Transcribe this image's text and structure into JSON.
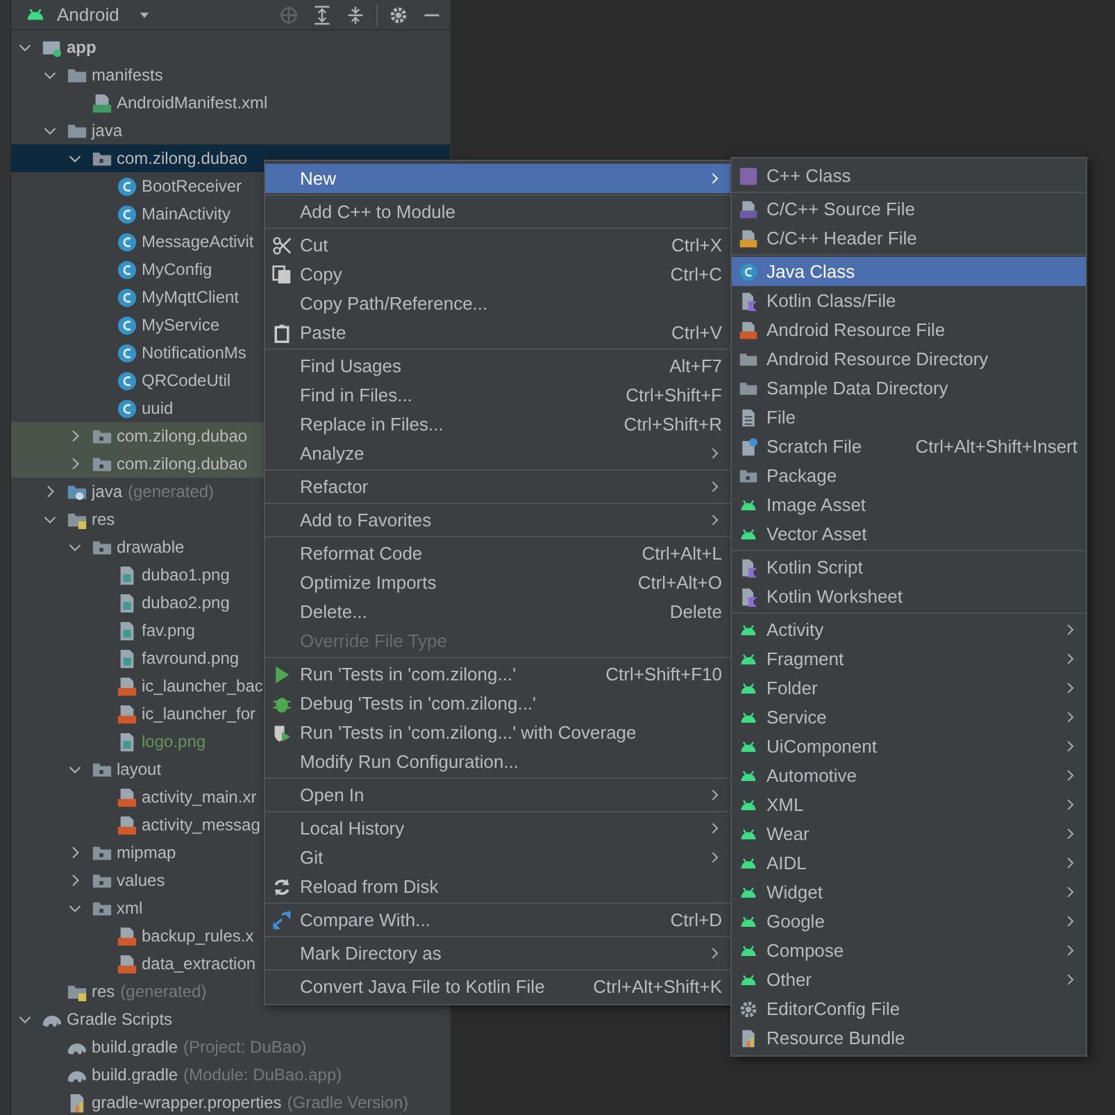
{
  "project_panel": {
    "view_selector": "Android",
    "tree": [
      {
        "label": "app",
        "kind": "module",
        "expanded": true,
        "selected": false,
        "children": [
          {
            "label": "manifests",
            "kind": "folder",
            "expanded": true,
            "selected": false,
            "children": [
              {
                "label": "AndroidManifest.xml",
                "kind": "manifest",
                "selected": false
              }
            ]
          },
          {
            "label": "java",
            "kind": "folder",
            "expanded": true,
            "selected": false,
            "children": [
              {
                "label": "com.zilong.dubao",
                "kind": "package",
                "expanded": true,
                "selected": true,
                "children": [
                  {
                    "label": "BootReceiver",
                    "kind": "class",
                    "selected": false
                  },
                  {
                    "label": "MainActivity",
                    "kind": "class",
                    "selected": false
                  },
                  {
                    "label": "MessageActivit",
                    "kind": "class",
                    "selected": false
                  },
                  {
                    "label": "MyConfig",
                    "kind": "class",
                    "selected": false
                  },
                  {
                    "label": "MyMqttClient",
                    "kind": "class",
                    "selected": false
                  },
                  {
                    "label": "MyService",
                    "kind": "class",
                    "selected": false
                  },
                  {
                    "label": "NotificationMs",
                    "kind": "class",
                    "selected": false
                  },
                  {
                    "label": "QRCodeUtil",
                    "kind": "class",
                    "selected": false
                  },
                  {
                    "label": "uuid",
                    "kind": "class",
                    "selected": false
                  }
                ]
              },
              {
                "label": "com.zilong.dubao",
                "kind": "package",
                "expanded": false,
                "selected": false,
                "test": true
              },
              {
                "label": "com.zilong.dubao",
                "kind": "package",
                "expanded": false,
                "selected": false,
                "test": true
              }
            ]
          },
          {
            "label": "java",
            "note": "(generated)",
            "kind": "generated",
            "expanded": false,
            "selected": false
          },
          {
            "label": "res",
            "kind": "res",
            "expanded": true,
            "selected": false,
            "children": [
              {
                "label": "drawable",
                "kind": "package",
                "expanded": true,
                "selected": false,
                "children": [
                  {
                    "label": "dubao1.png",
                    "kind": "image",
                    "selected": false
                  },
                  {
                    "label": "dubao2.png",
                    "kind": "image",
                    "selected": false
                  },
                  {
                    "label": "fav.png",
                    "kind": "image",
                    "selected": false
                  },
                  {
                    "label": "favround.png",
                    "kind": "image",
                    "selected": false
                  },
                  {
                    "label": "ic_launcher_bac",
                    "kind": "xml",
                    "selected": false
                  },
                  {
                    "label": "ic_launcher_for",
                    "kind": "xml",
                    "selected": false
                  },
                  {
                    "label": "logo.png",
                    "kind": "image",
                    "selected": false,
                    "added": true
                  }
                ]
              },
              {
                "label": "layout",
                "kind": "package",
                "expanded": true,
                "selected": false,
                "children": [
                  {
                    "label": "activity_main.xr",
                    "kind": "xml",
                    "selected": false
                  },
                  {
                    "label": "activity_messag",
                    "kind": "xml",
                    "selected": false
                  }
                ]
              },
              {
                "label": "mipmap",
                "kind": "package",
                "expanded": false,
                "selected": false
              },
              {
                "label": "values",
                "kind": "package",
                "expanded": false,
                "selected": false
              },
              {
                "label": "xml",
                "kind": "package",
                "expanded": true,
                "selected": false,
                "children": [
                  {
                    "label": "backup_rules.x",
                    "kind": "xml",
                    "selected": false
                  },
                  {
                    "label": "data_extraction",
                    "kind": "xml",
                    "selected": false
                  }
                ]
              }
            ]
          },
          {
            "label": "res",
            "note": "(generated)",
            "kind": "res",
            "selected": false
          }
        ]
      },
      {
        "label": "Gradle Scripts",
        "kind": "gradle",
        "expanded": true,
        "selected": false,
        "children": [
          {
            "label": "build.gradle",
            "note": "(Project: DuBao)",
            "kind": "gradle",
            "selected": false
          },
          {
            "label": "build.gradle",
            "note": "(Module: DuBao.app)",
            "kind": "gradle",
            "selected": false
          },
          {
            "label": "gradle-wrapper.properties",
            "note": "(Gradle Version)",
            "kind": "properties",
            "selected": false
          }
        ]
      }
    ]
  },
  "context_menu": {
    "groups": [
      [
        {
          "label": "New",
          "submenu": true,
          "selected": true
        }
      ],
      [
        {
          "label": "Add C++ to Module",
          "selected": false
        }
      ],
      [
        {
          "label": "Cut",
          "shortcut": "Ctrl+X",
          "kind": "scissors",
          "selected": false
        },
        {
          "label": "Copy",
          "shortcut": "Ctrl+C",
          "kind": "copy",
          "selected": false
        },
        {
          "label": "Copy Path/Reference...",
          "selected": false
        },
        {
          "label": "Paste",
          "shortcut": "Ctrl+V",
          "kind": "paste",
          "selected": false
        }
      ],
      [
        {
          "label": "Find Usages",
          "shortcut": "Alt+F7",
          "selected": false
        },
        {
          "label": "Find in Files...",
          "shortcut": "Ctrl+Shift+F",
          "selected": false
        },
        {
          "label": "Replace in Files...",
          "shortcut": "Ctrl+Shift+R",
          "selected": false
        },
        {
          "label": "Analyze",
          "submenu": true,
          "selected": false
        }
      ],
      [
        {
          "label": "Refactor",
          "submenu": true,
          "selected": false
        }
      ],
      [
        {
          "label": "Add to Favorites",
          "submenu": true,
          "selected": false
        }
      ],
      [
        {
          "label": "Reformat Code",
          "shortcut": "Ctrl+Alt+L",
          "selected": false
        },
        {
          "label": "Optimize Imports",
          "shortcut": "Ctrl+Alt+O",
          "selected": false
        },
        {
          "label": "Delete...",
          "shortcut": "Delete",
          "selected": false
        },
        {
          "label": "Override File Type",
          "disabled": true,
          "selected": false
        }
      ],
      [
        {
          "label": "Run 'Tests in 'com.zilong...'",
          "shortcut": "Ctrl+Shift+F10",
          "kind": "run",
          "selected": false
        },
        {
          "label": "Debug 'Tests in 'com.zilong...'",
          "kind": "bug",
          "selected": false
        },
        {
          "label": "Run 'Tests in 'com.zilong...' with Coverage",
          "kind": "coverage",
          "selected": false
        },
        {
          "label": "Modify Run Configuration...",
          "selected": false
        }
      ],
      [
        {
          "label": "Open In",
          "submenu": true,
          "selected": false
        }
      ],
      [
        {
          "label": "Local History",
          "submenu": true,
          "selected": false
        },
        {
          "label": "Git",
          "submenu": true,
          "selected": false
        },
        {
          "label": "Reload from Disk",
          "kind": "reload",
          "selected": false
        }
      ],
      [
        {
          "label": "Compare With...",
          "shortcut": "Ctrl+D",
          "kind": "compare",
          "selected": false
        }
      ],
      [
        {
          "label": "Mark Directory as",
          "submenu": true,
          "selected": false
        }
      ],
      [
        {
          "label": "Convert Java File to Kotlin File",
          "shortcut": "Ctrl+Alt+Shift+K",
          "selected": false
        }
      ]
    ]
  },
  "new_submenu": {
    "groups": [
      [
        {
          "label": "C++ Class",
          "kind": "cpp-class",
          "selected": false
        }
      ],
      [
        {
          "label": "C/C++ Source File",
          "kind": "cpp-file",
          "selected": false
        },
        {
          "label": "C/C++ Header File",
          "kind": "header-file",
          "selected": false
        }
      ],
      [
        {
          "label": "Java Class",
          "kind": "class",
          "selected": true
        },
        {
          "label": "Kotlin Class/File",
          "kind": "kotlin",
          "selected": false
        },
        {
          "label": "Android Resource File",
          "kind": "xml",
          "selected": false
        },
        {
          "label": "Android Resource Directory",
          "kind": "folder",
          "selected": false
        },
        {
          "label": "Sample Data Directory",
          "kind": "folder",
          "selected": false
        },
        {
          "label": "File",
          "kind": "file",
          "selected": false
        },
        {
          "label": "Scratch File",
          "shortcut": "Ctrl+Alt+Shift+Insert",
          "kind": "scratch",
          "selected": false
        },
        {
          "label": "Package",
          "kind": "package",
          "selected": false
        },
        {
          "label": "Image Asset",
          "kind": "android",
          "selected": false
        },
        {
          "label": "Vector Asset",
          "kind": "android",
          "selected": false
        }
      ],
      [
        {
          "label": "Kotlin Script",
          "kind": "kotlin",
          "selected": false
        },
        {
          "label": "Kotlin Worksheet",
          "kind": "kotlin",
          "selected": false
        }
      ],
      [
        {
          "label": "Activity",
          "kind": "android",
          "submenu": true,
          "selected": false
        },
        {
          "label": "Fragment",
          "kind": "android",
          "submenu": true,
          "selected": false
        },
        {
          "label": "Folder",
          "kind": "android",
          "submenu": true,
          "selected": false
        },
        {
          "label": "Service",
          "kind": "android",
          "submenu": true,
          "selected": false
        },
        {
          "label": "UiComponent",
          "kind": "android",
          "submenu": true,
          "selected": false
        },
        {
          "label": "Automotive",
          "kind": "android",
          "submenu": true,
          "selected": false
        },
        {
          "label": "XML",
          "kind": "android",
          "submenu": true,
          "selected": false
        },
        {
          "label": "Wear",
          "kind": "android",
          "submenu": true,
          "selected": false
        },
        {
          "label": "AIDL",
          "kind": "android",
          "submenu": true,
          "selected": false
        },
        {
          "label": "Widget",
          "kind": "android",
          "submenu": true,
          "selected": false
        },
        {
          "label": "Google",
          "kind": "android",
          "submenu": true,
          "selected": false
        },
        {
          "label": "Compose",
          "kind": "android",
          "submenu": true,
          "selected": false
        },
        {
          "label": "Other",
          "kind": "android",
          "submenu": true,
          "selected": false
        },
        {
          "label": "EditorConfig File",
          "kind": "gear",
          "selected": false
        },
        {
          "label": "Resource Bundle",
          "kind": "properties",
          "selected": false
        }
      ]
    ]
  }
}
